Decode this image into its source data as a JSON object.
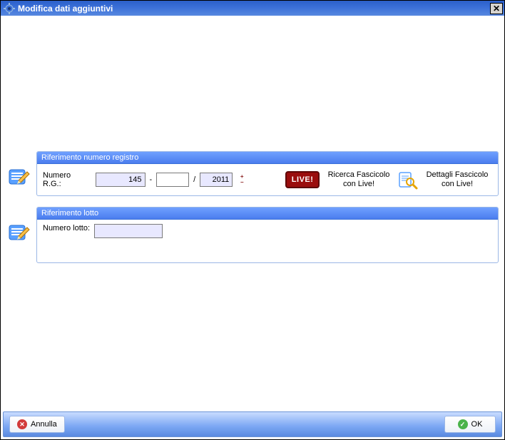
{
  "window": {
    "title": "Modifica dati aggiuntivi"
  },
  "sections": {
    "registro": {
      "header": "Riferimento numero registro",
      "label": "Numero R.G.:",
      "value1": "145",
      "value2": "",
      "sep1": "-",
      "sep2": "/",
      "year": "2011",
      "ricerca_label": "Ricerca Fascicolo con Live!",
      "dettagli_label": "Dettagli Fascicolo con Live!",
      "live_badge": "LIVE!"
    },
    "lotto": {
      "header": "Riferimento lotto",
      "label": "Numero lotto:",
      "value": ""
    }
  },
  "footer": {
    "cancel": "Annulla",
    "ok": "OK"
  }
}
